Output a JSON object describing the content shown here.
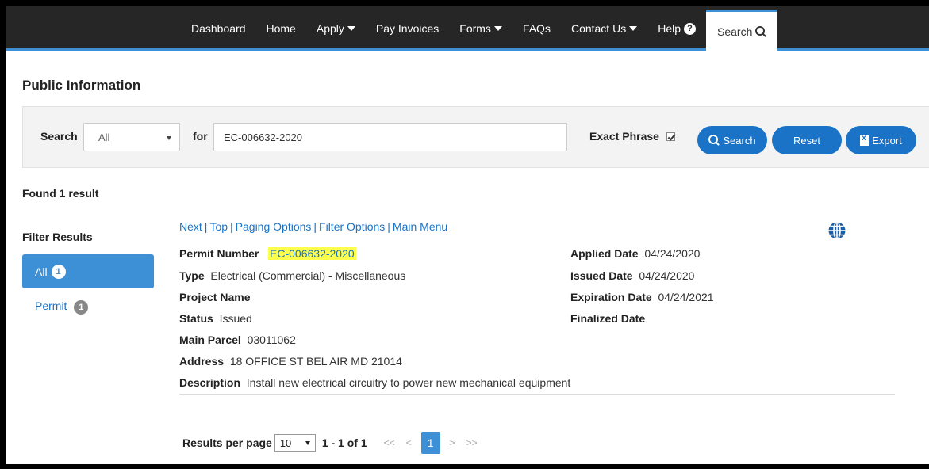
{
  "nav": {
    "items": [
      {
        "label": "Dashboard"
      },
      {
        "label": "Home"
      },
      {
        "label": "Apply",
        "dropdown": true
      },
      {
        "label": "Pay Invoices"
      },
      {
        "label": "Forms",
        "dropdown": true
      },
      {
        "label": "FAQs"
      },
      {
        "label": "Contact Us",
        "dropdown": true
      },
      {
        "label": "Help",
        "help_icon": true
      }
    ],
    "search_label": "Search"
  },
  "page": {
    "title": "Public Information"
  },
  "search": {
    "search_label": "Search",
    "scope_value": "All",
    "for_label": "for",
    "query_value": "EC-006632-2020",
    "exact_phrase_label": "Exact Phrase",
    "exact_phrase_checked": true,
    "search_button": "Search",
    "reset_button": "Reset",
    "export_button": "Export"
  },
  "results": {
    "found_text": "Found 1 result",
    "filter_title": "Filter Results",
    "filters": [
      {
        "label": "All",
        "count": "1"
      },
      {
        "label": "Permit",
        "count": "1"
      }
    ]
  },
  "record": {
    "links": [
      "Next",
      "Top",
      "Paging Options",
      "Filter Options",
      "Main Menu"
    ],
    "left": {
      "permit_number_label": "Permit Number",
      "permit_number_value": "EC-006632-2020",
      "type_label": "Type",
      "type_value": "Electrical (Commercial) - Miscellaneous",
      "project_name_label": "Project Name",
      "status_label": "Status",
      "status_value": "Issued",
      "main_parcel_label": "Main Parcel",
      "main_parcel_value": "03011062",
      "address_label": "Address",
      "address_value": "18 OFFICE ST BEL AIR MD 21014",
      "description_label": "Description",
      "description_value": "Install new electrical circuitry to power new mechanical equipment"
    },
    "right": {
      "applied_label": "Applied Date",
      "applied_value": "04/24/2020",
      "issued_label": "Issued Date",
      "issued_value": "04/24/2020",
      "expiration_label": "Expiration Date",
      "expiration_value": "04/24/2021",
      "finalized_label": "Finalized Date"
    }
  },
  "pager": {
    "per_page_label": "Results per page",
    "per_page_value": "10",
    "range_text": "1 - 1 of 1",
    "first": "<<",
    "prev": "<",
    "current": "1",
    "next": ">",
    "last": ">>"
  },
  "colors": {
    "nav_bg": "#262626",
    "accent": "#3d8fd6",
    "button_blue": "#1a73c6",
    "highlight": "#ffff4d"
  }
}
